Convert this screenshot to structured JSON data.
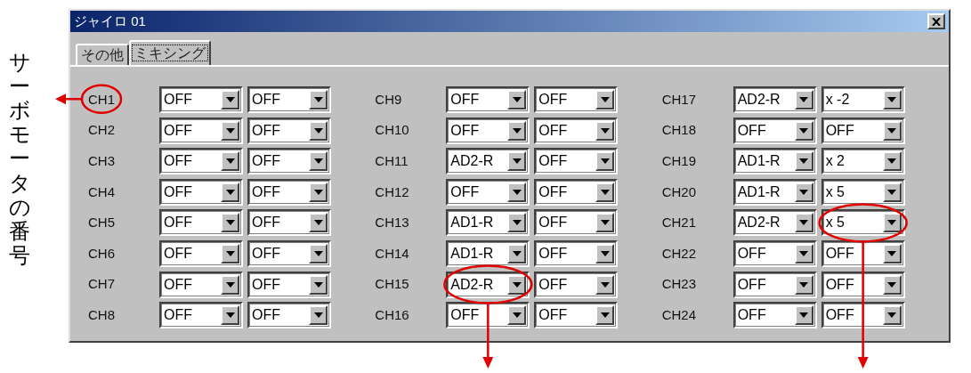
{
  "side_label": "サーボモータの番号",
  "window": {
    "title": "ジャイロ 01"
  },
  "tabs": [
    {
      "label": "その他",
      "selected": false
    },
    {
      "label": "ミキシング",
      "selected": true
    }
  ],
  "channels": [
    {
      "label": "CH1",
      "label_callout_left": true,
      "selects": [
        {
          "value": "OFF"
        },
        {
          "value": "OFF"
        }
      ]
    },
    {
      "label": "CH2",
      "selects": [
        {
          "value": "OFF"
        },
        {
          "value": "OFF"
        }
      ]
    },
    {
      "label": "CH3",
      "selects": [
        {
          "value": "OFF"
        },
        {
          "value": "OFF"
        }
      ]
    },
    {
      "label": "CH4",
      "selects": [
        {
          "value": "OFF"
        },
        {
          "value": "OFF"
        }
      ]
    },
    {
      "label": "CH5",
      "selects": [
        {
          "value": "OFF"
        },
        {
          "value": "OFF"
        }
      ]
    },
    {
      "label": "CH6",
      "selects": [
        {
          "value": "OFF"
        },
        {
          "value": "OFF"
        }
      ]
    },
    {
      "label": "CH7",
      "selects": [
        {
          "value": "OFF"
        },
        {
          "value": "OFF"
        }
      ]
    },
    {
      "label": "CH8",
      "selects": [
        {
          "value": "OFF"
        },
        {
          "value": "OFF"
        }
      ]
    },
    {
      "label": "CH9",
      "selects": [
        {
          "value": "OFF"
        },
        {
          "value": "OFF"
        }
      ]
    },
    {
      "label": "CH10",
      "selects": [
        {
          "value": "OFF"
        },
        {
          "value": "OFF"
        }
      ]
    },
    {
      "label": "CH11",
      "selects": [
        {
          "value": "AD2-R"
        },
        {
          "value": "OFF"
        }
      ]
    },
    {
      "label": "CH12",
      "selects": [
        {
          "value": "OFF"
        },
        {
          "value": "OFF"
        }
      ]
    },
    {
      "label": "CH13",
      "selects": [
        {
          "value": "AD1-R"
        },
        {
          "value": "OFF"
        }
      ]
    },
    {
      "label": "CH14",
      "selects": [
        {
          "value": "AD1-R"
        },
        {
          "value": "OFF"
        }
      ]
    },
    {
      "label": "CH15",
      "selects": [
        {
          "value": "AD2-R",
          "callout_down": true
        },
        {
          "value": "OFF"
        }
      ]
    },
    {
      "label": "CH16",
      "selects": [
        {
          "value": "OFF"
        },
        {
          "value": "OFF"
        }
      ]
    },
    {
      "label": "CH17",
      "selects": [
        {
          "value": "AD2-R"
        },
        {
          "value": "x -2"
        }
      ]
    },
    {
      "label": "CH18",
      "selects": [
        {
          "value": "OFF"
        },
        {
          "value": "OFF"
        }
      ]
    },
    {
      "label": "CH19",
      "selects": [
        {
          "value": "AD1-R"
        },
        {
          "value": "x 2"
        }
      ]
    },
    {
      "label": "CH20",
      "selects": [
        {
          "value": "AD1-R"
        },
        {
          "value": "x 5"
        }
      ]
    },
    {
      "label": "CH21",
      "selects": [
        {
          "value": "AD2-R"
        },
        {
          "value": "x 5",
          "callout_down": true
        }
      ]
    },
    {
      "label": "CH22",
      "selects": [
        {
          "value": "OFF"
        },
        {
          "value": "OFF"
        }
      ]
    },
    {
      "label": "CH23",
      "selects": [
        {
          "value": "OFF"
        },
        {
          "value": "OFF"
        }
      ]
    },
    {
      "label": "CH24",
      "selects": [
        {
          "value": "OFF"
        },
        {
          "value": "OFF"
        }
      ]
    }
  ]
}
